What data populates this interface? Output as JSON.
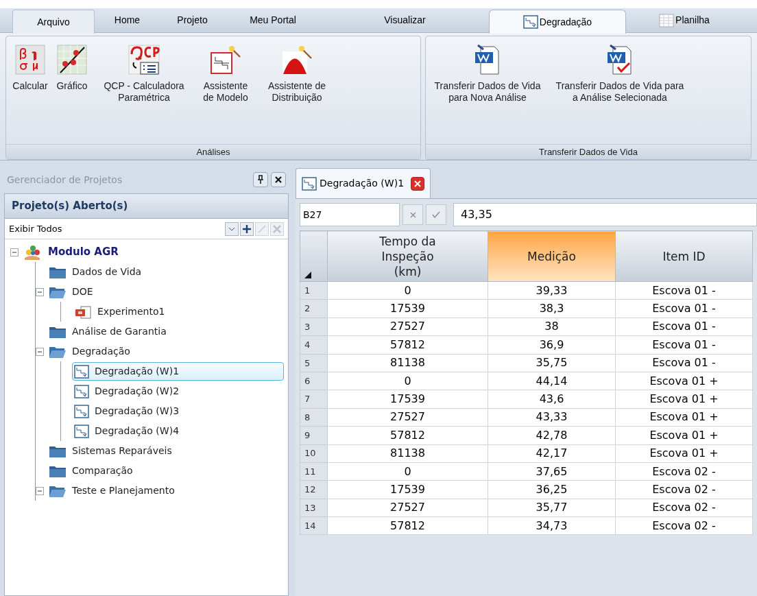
{
  "ribbon": {
    "tabs": [
      {
        "label": "Arquivo",
        "kind": "file",
        "selected": false
      },
      {
        "label": "Home",
        "kind": "plain",
        "selected": false
      },
      {
        "label": "Projeto",
        "kind": "plain",
        "selected": false
      },
      {
        "label": "Meu Portal",
        "kind": "plain",
        "selected": false
      },
      {
        "label": "Visualizar",
        "kind": "plain",
        "selected": false
      },
      {
        "label": "Degradação",
        "kind": "degradation",
        "selected": true
      },
      {
        "label": "Planilha",
        "kind": "sheet",
        "selected": false
      }
    ],
    "groups": [
      {
        "label": "Análises",
        "buttons": [
          {
            "label": "Calcular",
            "kind": "greek"
          },
          {
            "label": "Gráfico",
            "kind": "plot"
          },
          {
            "label": "QCP - Calculadora Paramétrica",
            "kind": "qcp"
          },
          {
            "label": "Assistente de Modelo",
            "kind": "model-wizard"
          },
          {
            "label": "Assistente de Distribuição",
            "kind": "dist-wizard"
          }
        ]
      },
      {
        "label": "Transferir Dados de Vida",
        "buttons": [
          {
            "label": "Transferir Dados de Vida para Nova Análise",
            "kind": "doc"
          },
          {
            "label": "Transferir Dados de Vida para a Análise Selecionada",
            "kind": "doc-check"
          }
        ]
      }
    ]
  },
  "project_manager": {
    "title": "Gerenciador de Projetos",
    "header": "Projeto(s) Aberto(s)",
    "filter": "Exibir Todos",
    "tree": [
      {
        "label": "Modulo AGR",
        "kind": "project",
        "expanded": true,
        "selected": false,
        "children": [
          {
            "label": "Dados de Vida",
            "kind": "folder",
            "selected": false
          },
          {
            "label": "DOE",
            "kind": "folder",
            "expanded": true,
            "selected": false,
            "children": [
              {
                "label": "Experimento1",
                "kind": "experiment",
                "selected": false
              }
            ]
          },
          {
            "label": "Análise de Garantia",
            "kind": "folder",
            "selected": false
          },
          {
            "label": "Degradação",
            "kind": "folder",
            "expanded": true,
            "selected": false,
            "children": [
              {
                "label": "Degradação (W)1",
                "kind": "degradation",
                "selected": true
              },
              {
                "label": "Degradação (W)2",
                "kind": "degradation",
                "selected": false
              },
              {
                "label": "Degradação (W)3",
                "kind": "degradation",
                "selected": false
              },
              {
                "label": "Degradação (W)4",
                "kind": "degradation",
                "selected": false
              }
            ]
          },
          {
            "label": "Sistemas Reparáveis",
            "kind": "folder",
            "selected": false
          },
          {
            "label": "Comparação",
            "kind": "folder",
            "selected": false
          },
          {
            "label": "Teste e Planejamento",
            "kind": "folder",
            "expanded": true,
            "selected": false
          }
        ]
      }
    ]
  },
  "document": {
    "tab": "Degradação (W)1",
    "cell_ref": "B27",
    "cell_value": "43,35",
    "columns": [
      {
        "selected": false
      },
      {
        "label": "Tempo da Inspeção (km)",
        "selected": false
      },
      {
        "label": "Medição",
        "selected": true
      },
      {
        "label": "Item ID",
        "selected": false
      }
    ],
    "rows": [
      [
        "1",
        "0",
        "39,33",
        "Escova 01 -"
      ],
      [
        "2",
        "17539",
        "38,3",
        "Escova 01 -"
      ],
      [
        "3",
        "27527",
        "38",
        "Escova 01 -"
      ],
      [
        "4",
        "57812",
        "36,9",
        "Escova 01 -"
      ],
      [
        "5",
        "81138",
        "35,75",
        "Escova 01 -"
      ],
      [
        "6",
        "0",
        "44,14",
        "Escova 01 +"
      ],
      [
        "7",
        "17539",
        "43,6",
        "Escova 01 +"
      ],
      [
        "8",
        "27527",
        "43,33",
        "Escova 01 +"
      ],
      [
        "9",
        "57812",
        "42,78",
        "Escova 01 +"
      ],
      [
        "10",
        "81138",
        "42,17",
        "Escova 01 +"
      ],
      [
        "11",
        "0",
        "37,65",
        "Escova 02 -"
      ],
      [
        "12",
        "17539",
        "36,25",
        "Escova 02 -"
      ],
      [
        "13",
        "27527",
        "35,77",
        "Escova 02 -"
      ],
      [
        "14",
        "57812",
        "34,73",
        "Escova 02 -"
      ]
    ]
  }
}
